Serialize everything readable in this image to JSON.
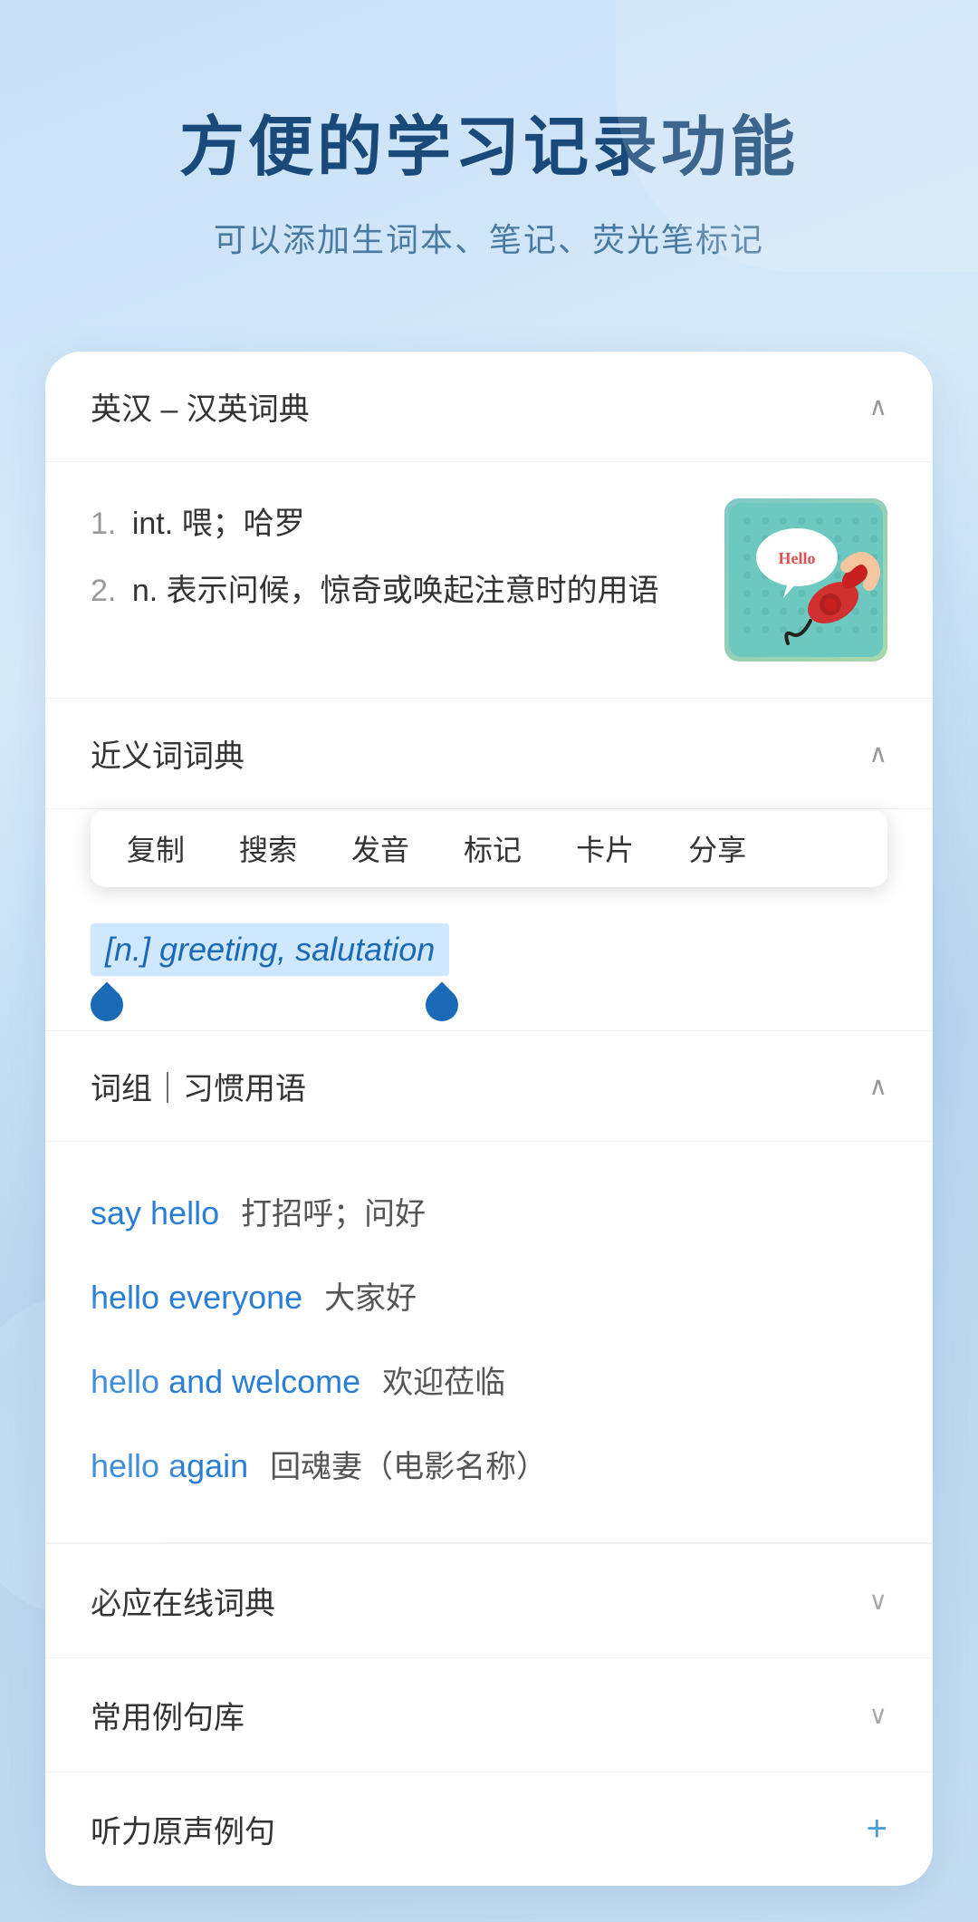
{
  "header": {
    "main_title": "方便的学习记录功能",
    "sub_title": "可以添加生词本、笔记、荧光笔标记"
  },
  "english_chinese_dict": {
    "section_title": "英汉 – 汉英词典",
    "definitions": [
      {
        "number": "1.",
        "text": "int. 喂；哈罗"
      },
      {
        "number": "2.",
        "text": "n. 表示问候，惊奇或唤起注意时的用语"
      }
    ]
  },
  "synonyms": {
    "section_title": "近义词词典",
    "context_menu": {
      "items": [
        "复制",
        "搜索",
        "发音",
        "标记",
        "卡片",
        "分享"
      ]
    },
    "highlighted": "[n.] greeting, salutation"
  },
  "phrases": {
    "section_title": "词组｜习惯用语",
    "items": [
      {
        "english": "say hello",
        "chinese": "打招呼；问好"
      },
      {
        "english": "hello everyone",
        "chinese": "大家好"
      },
      {
        "english": "hello and welcome",
        "chinese": "欢迎莅临"
      },
      {
        "english": "hello again",
        "chinese": "回魂妻（电影名称）"
      }
    ]
  },
  "collapsed_sections": [
    {
      "title": "必应在线词典",
      "icon": "chevron-down"
    },
    {
      "title": "常用例句库",
      "icon": "chevron-down"
    },
    {
      "title": "听力原声例句",
      "icon": "plus"
    }
  ]
}
